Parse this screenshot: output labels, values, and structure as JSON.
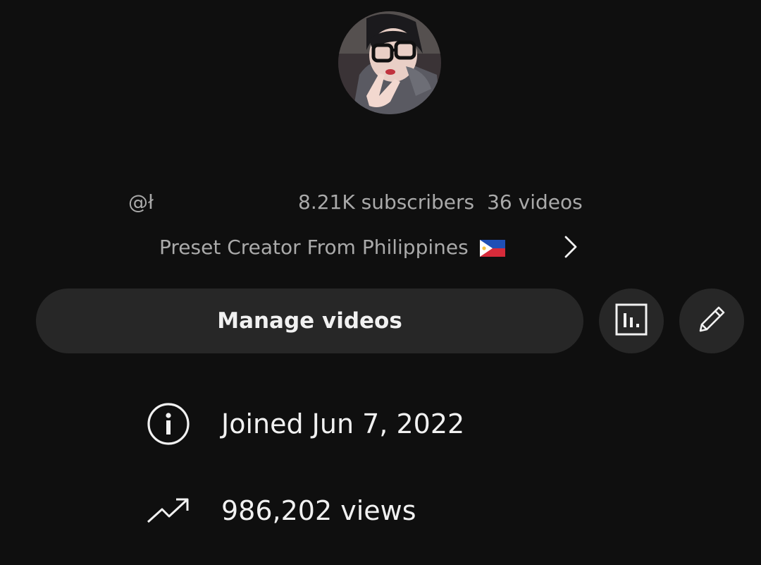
{
  "channel": {
    "handle": "@ł",
    "subscribers": "8.21K subscribers",
    "videos": "36 videos",
    "description": "Preset Creator From Philippines",
    "description_flag": "philippines-flag-emoji"
  },
  "actions": {
    "manage_label": "Manage videos",
    "analytics_icon": "analytics-icon",
    "edit_icon": "pencil-icon"
  },
  "about": {
    "joined": "Joined Jun 7, 2022",
    "views": "986,202 views"
  },
  "colors": {
    "background": "#0f0f0f",
    "button_bg": "#272727",
    "primary_text": "#f1f1f1",
    "secondary_text": "#aaaaaa"
  }
}
